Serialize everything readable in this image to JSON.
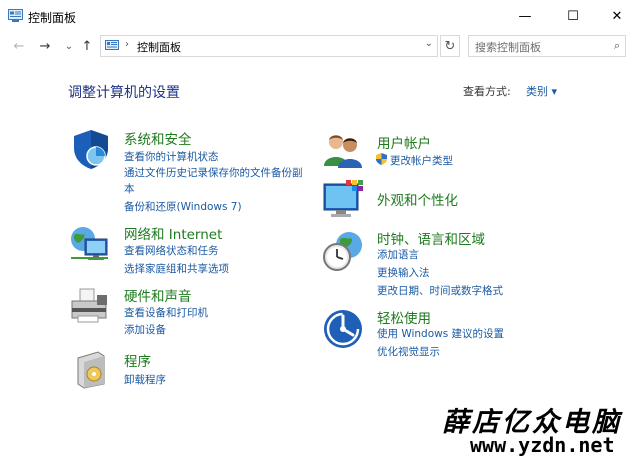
{
  "window": {
    "title": "控制面板",
    "minimize": "—",
    "maximize": "☐",
    "close": "✕"
  },
  "nav": {
    "back": "←",
    "forward": "→",
    "recent": "⌄",
    "up": "↑"
  },
  "address": {
    "separator": "›",
    "path": "控制面板",
    "dropdown": "⌄",
    "refresh": "↻"
  },
  "search": {
    "placeholder": "搜索控制面板",
    "icon": "⌕"
  },
  "page": {
    "heading": "调整计算机的设置",
    "view_by_label": "查看方式:",
    "view_by_value": "类别 ▾"
  },
  "categories": {
    "system": {
      "title": "系统和安全",
      "links": [
        "查看你的计算机状态",
        "通过文件历史记录保存你的文件备份副",
        "本",
        "备份和还原(Windows 7)"
      ]
    },
    "network": {
      "title": "网络和 Internet",
      "links": [
        "查看网络状态和任务",
        "选择家庭组和共享选项"
      ]
    },
    "hardware": {
      "title": "硬件和声音",
      "links": [
        "查看设备和打印机",
        "添加设备"
      ]
    },
    "programs": {
      "title": "程序",
      "links": [
        "卸载程序"
      ]
    },
    "user": {
      "title": "用户帐户",
      "links": [
        "更改帐户类型"
      ]
    },
    "appearance": {
      "title": "外观和个性化",
      "links": []
    },
    "clock": {
      "title": "时钟、语言和区域",
      "links": [
        "添加语言",
        "更换输入法",
        "更改日期、时间或数字格式"
      ]
    },
    "ease": {
      "title": "轻松使用",
      "links": [
        "使用 Windows 建议的设置",
        "优化视觉显示"
      ]
    }
  },
  "watermark": {
    "text": "薛店亿众电脑",
    "url": "www.yzdn.net"
  },
  "colors": {
    "heading": "#1e3287",
    "category_title": "#1e7a1e",
    "link": "#1a5aa3"
  }
}
